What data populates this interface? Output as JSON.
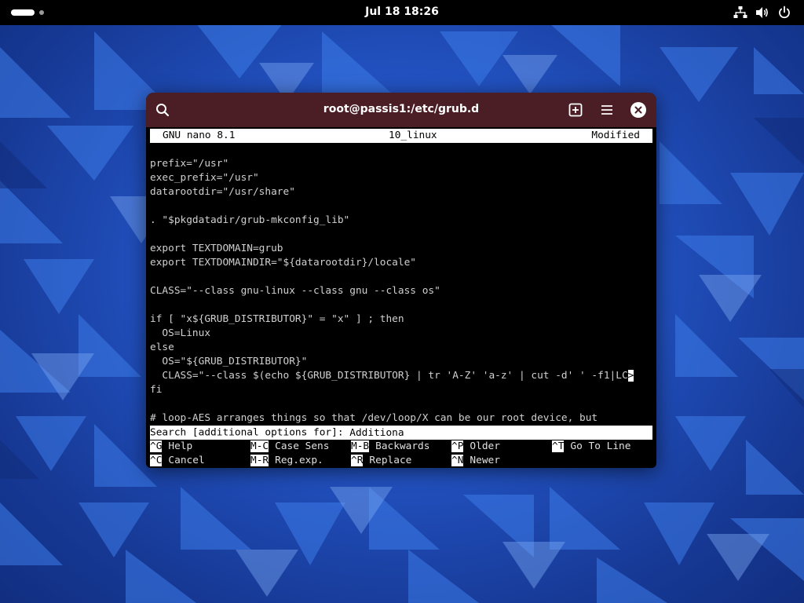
{
  "topbar": {
    "clock": "Jul 18  18:26",
    "icons": [
      "activities-indicator",
      "network-icon",
      "volume-icon",
      "power-icon"
    ]
  },
  "terminal": {
    "title": "root@passis1:/etc/grub.d",
    "titlebar_color": "#4a1e24",
    "icons": [
      "search-icon",
      "new-tab-icon",
      "hamburger-menu-icon",
      "close-icon"
    ]
  },
  "nano": {
    "version": "GNU nano 8.1",
    "filename": "10_linux",
    "status": "Modified",
    "lines": [
      "",
      "prefix=\"/usr\"",
      "exec_prefix=\"/usr\"",
      "datarootdir=\"/usr/share\"",
      "",
      ". \"$pkgdatadir/grub-mkconfig_lib\"",
      "",
      "export TEXTDOMAIN=grub",
      "export TEXTDOMAINDIR=\"${datarootdir}/locale\"",
      "",
      "CLASS=\"--class gnu-linux --class gnu --class os\"",
      "",
      "if [ \"x${GRUB_DISTRIBUTOR}\" = \"x\" ] ; then",
      "  OS=Linux",
      "else",
      "  OS=\"${GRUB_DISTRIBUTOR}\"",
      "  CLASS=\"--class $(echo ${GRUB_DISTRIBUTOR} | tr 'A-Z' 'a-z' | cut -d' ' -f1|LC",
      "fi",
      "",
      "# loop-AES arranges things so that /dev/loop/X can be our root device, but"
    ],
    "overflow_marker": ">",
    "search": {
      "prompt": "Search [additional options for]: ",
      "value": "Additiona"
    },
    "shortcuts_row1": [
      {
        "key": "^G",
        "label": "Help"
      },
      {
        "key": "M-C",
        "label": "Case Sens"
      },
      {
        "key": "M-B",
        "label": "Backwards"
      },
      {
        "key": "^P",
        "label": "Older"
      },
      {
        "key": "^T",
        "label": "Go To Line"
      }
    ],
    "shortcuts_row2": [
      {
        "key": "^C",
        "label": "Cancel"
      },
      {
        "key": "M-R",
        "label": "Reg.exp."
      },
      {
        "key": "^R",
        "label": "Replace"
      },
      {
        "key": "^N",
        "label": "Newer"
      }
    ]
  }
}
